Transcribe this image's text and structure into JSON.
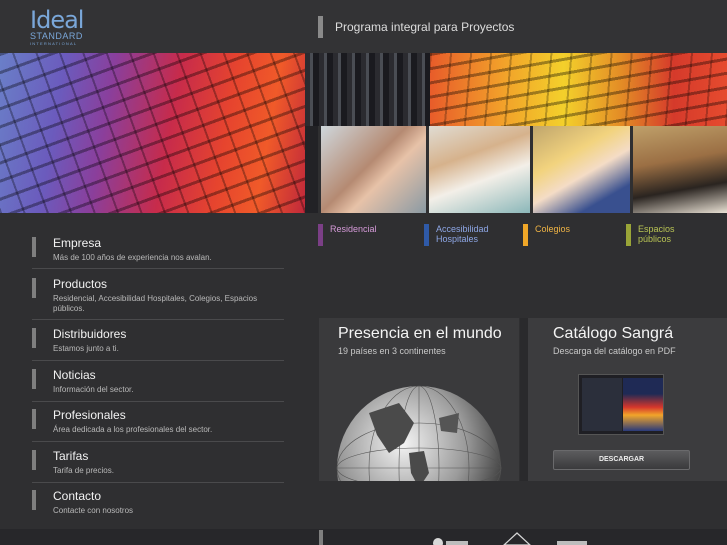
{
  "header": {
    "logo_line1": "Ideal",
    "logo_line2": "STANDARD",
    "logo_line3": "INTERNATIONAL",
    "title": "Programa integral para Proyectos"
  },
  "categories": [
    {
      "label": "Residencial",
      "color": "#7b3f86"
    },
    {
      "label": "Accesibilidad Hospitales",
      "color": "#2f5aa8"
    },
    {
      "label": "Colegios",
      "color": "#f0a728"
    },
    {
      "label": "Espacios públicos",
      "color": "#9aa538"
    }
  ],
  "nav": [
    {
      "title": "Empresa",
      "subtitle": "Más de 100 años de experiencia nos avalan."
    },
    {
      "title": "Productos",
      "subtitle": "Residencial, Accesibilidad Hospitales, Colegios, Espacios públicos."
    },
    {
      "title": "Distribuidores",
      "subtitle": "Estamos junto a ti."
    },
    {
      "title": "Noticias",
      "subtitle": "Información del sector."
    },
    {
      "title": "Profesionales",
      "subtitle": "Área dedicada a los profesionales del sector."
    },
    {
      "title": "Tarifas",
      "subtitle": "Tarifa de precios."
    },
    {
      "title": "Contacto",
      "subtitle": "Contacte con nosotros"
    }
  ],
  "world": {
    "title": "Presencia en el mundo",
    "subtitle": "19 países en 3 continentes"
  },
  "catalog": {
    "title": "Catálogo Sangrá",
    "subtitle": "Descarga del catálogo en PDF",
    "button": "DESCARGAR"
  },
  "colors": {
    "background": "#2f2f31",
    "logo_blue": "#7aa7d9"
  }
}
